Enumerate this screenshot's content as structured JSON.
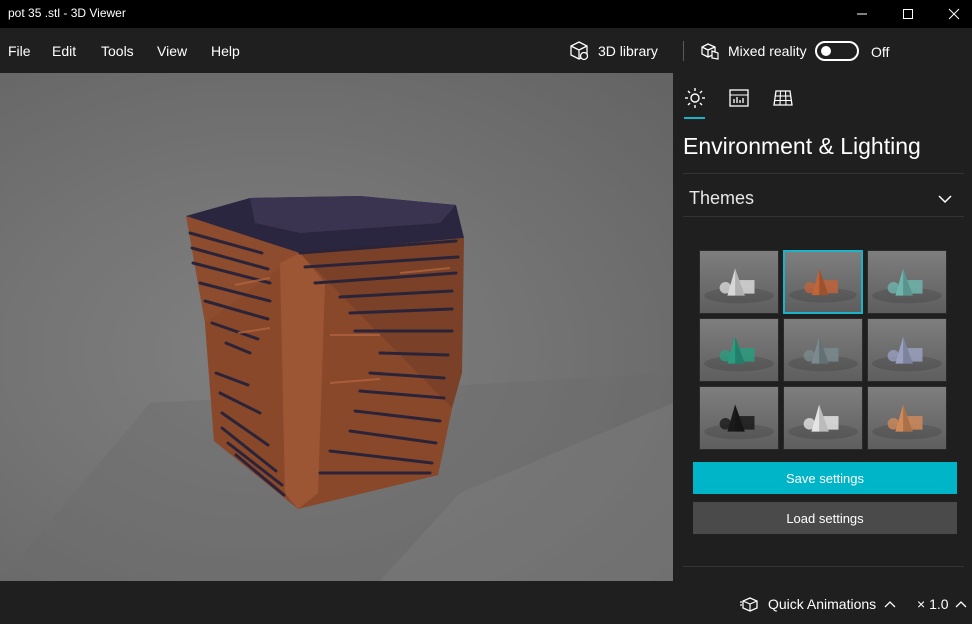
{
  "window": {
    "title": "pot 35 .stl - 3D Viewer"
  },
  "menu": {
    "items": [
      "File",
      "Edit",
      "Tools",
      "View",
      "Help"
    ],
    "library_label": "3D library",
    "mixed_reality_label": "Mixed reality",
    "mixed_reality_state": "Off",
    "mixed_reality_on": false
  },
  "panel": {
    "tabs": [
      "sun-icon",
      "stats-icon",
      "grid-icon"
    ],
    "active_tab": 0,
    "title": "Environment & Lighting",
    "themes_label": "Themes",
    "themes": [
      {
        "name": "theme-1",
        "accent": "#d8d8d8",
        "selected": false
      },
      {
        "name": "theme-2",
        "accent": "#c0643a",
        "selected": true
      },
      {
        "name": "theme-3",
        "accent": "#6fb5ad",
        "selected": false
      },
      {
        "name": "theme-4",
        "accent": "#2a9c80",
        "selected": false
      },
      {
        "name": "theme-5",
        "accent": "#7a8a8e",
        "selected": false
      },
      {
        "name": "theme-6",
        "accent": "#9aa0c0",
        "selected": false
      },
      {
        "name": "theme-7",
        "accent": "#1a1a1a",
        "selected": false
      },
      {
        "name": "theme-8",
        "accent": "#e4e4e4",
        "selected": false
      },
      {
        "name": "theme-9",
        "accent": "#d08a5a",
        "selected": false
      }
    ],
    "save_label": "Save settings",
    "load_label": "Load settings"
  },
  "status": {
    "animations_label": "Quick Animations",
    "speed_label": "× 1.0"
  },
  "colors": {
    "accent": "#00b5c8",
    "model": "#8a4a2c",
    "background": "#1f1f1f"
  }
}
